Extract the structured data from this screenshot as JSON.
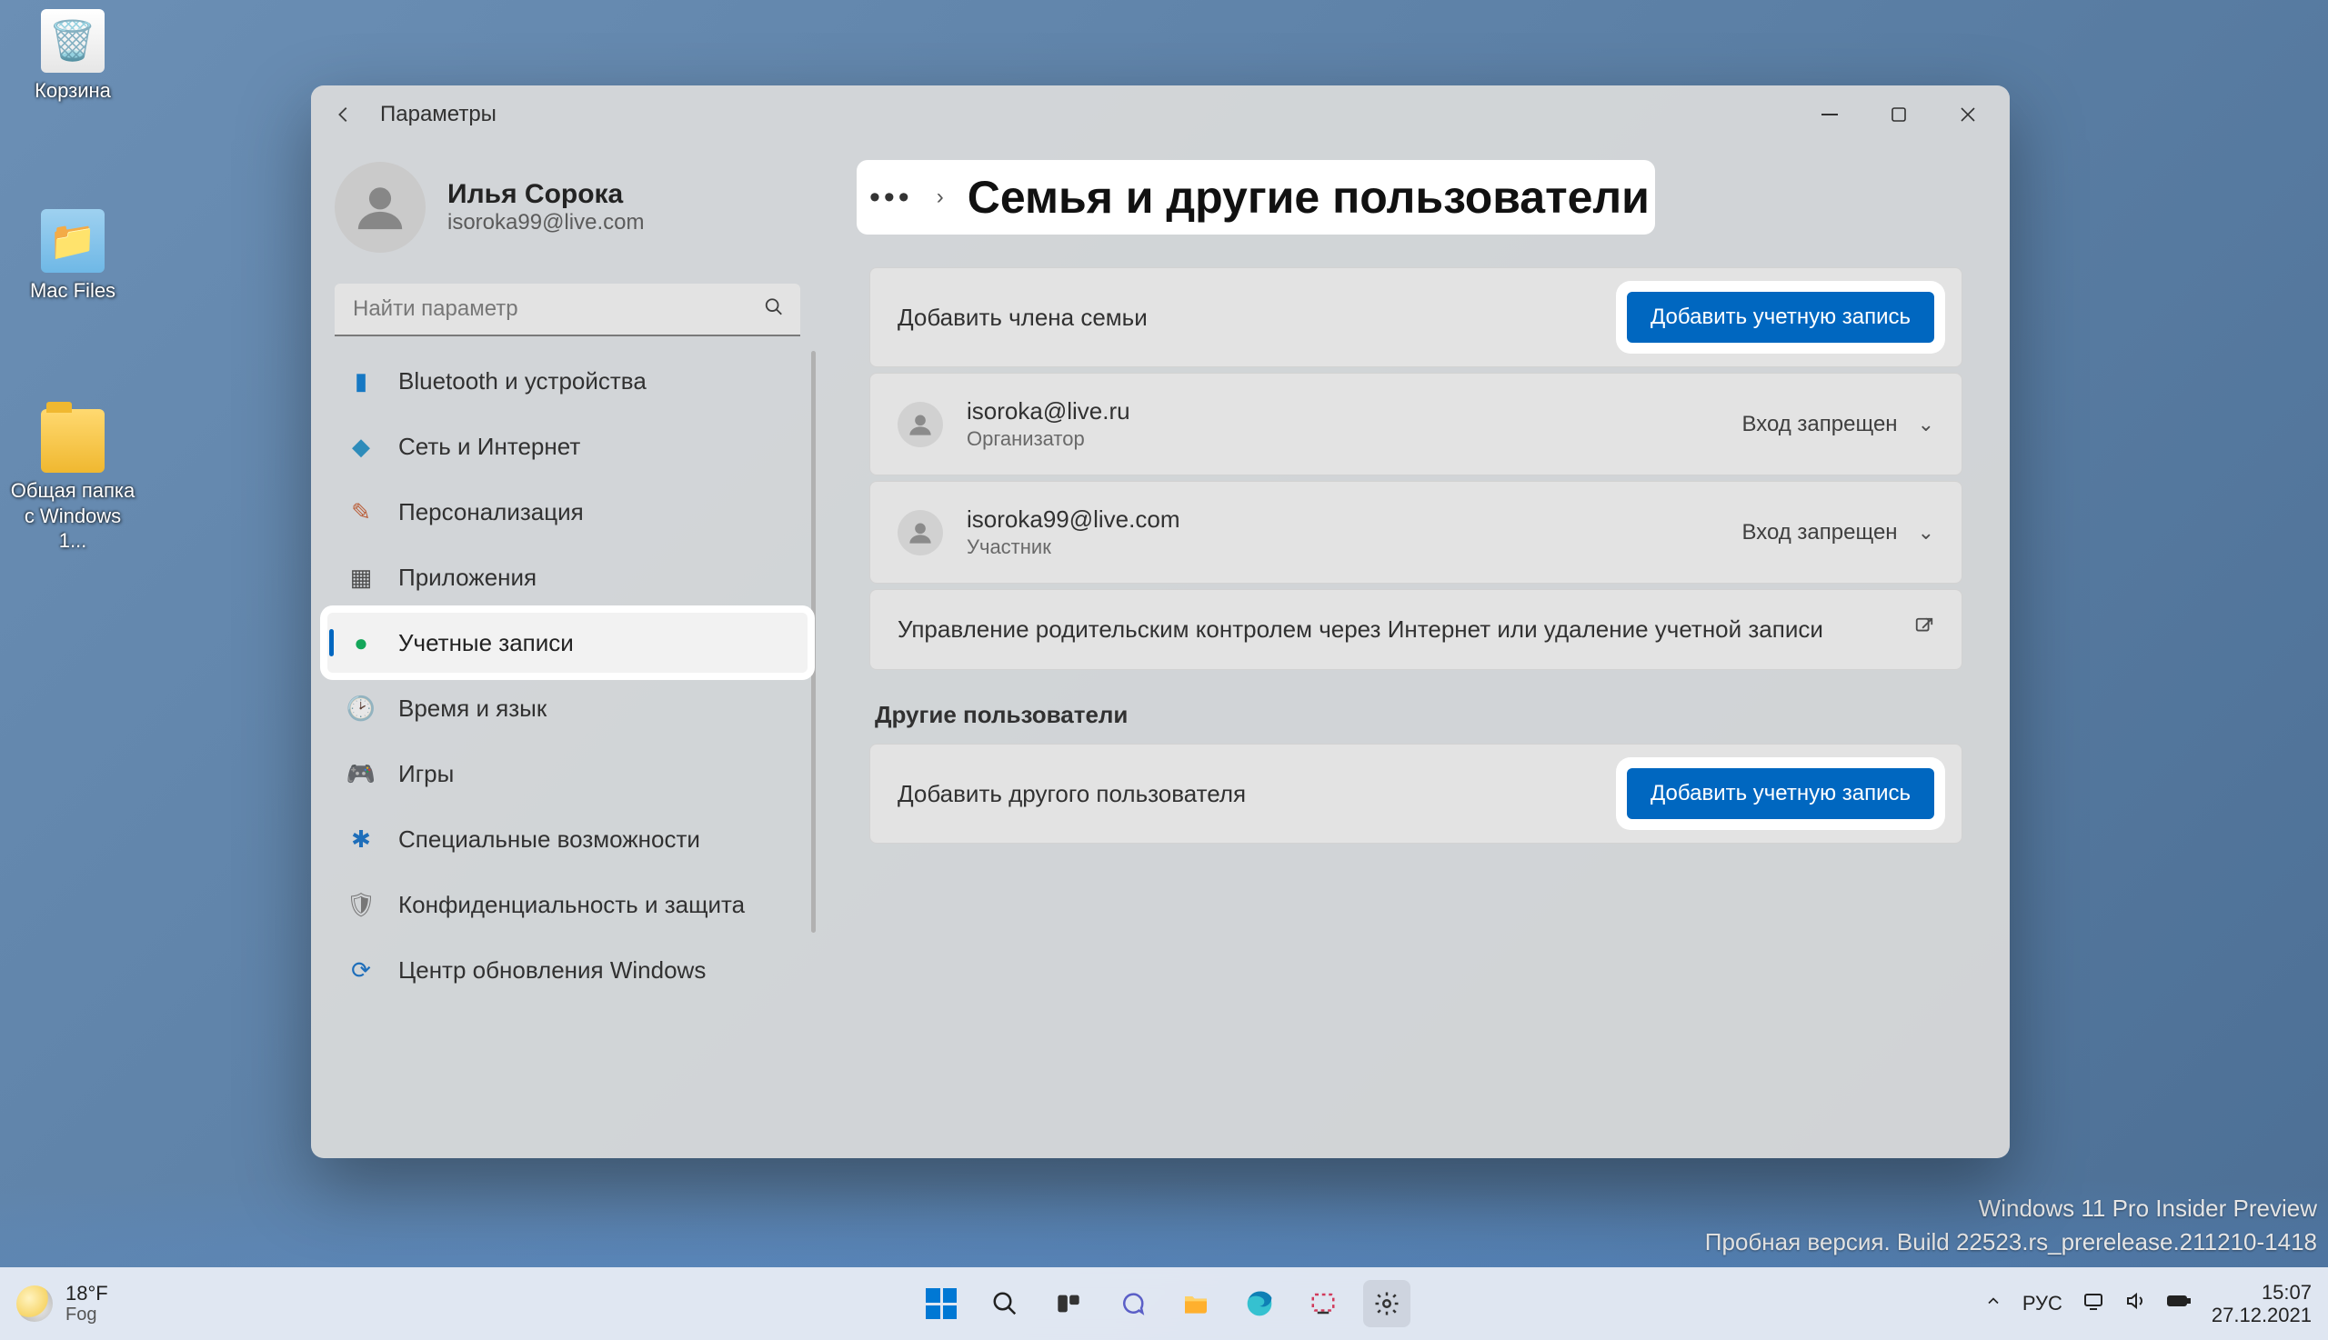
{
  "desktop": {
    "recycle": "Корзина",
    "mac": "Mac Files",
    "shared": "Общая папка с Windows 1..."
  },
  "watermark": {
    "line1": "Windows 11 Pro Insider Preview",
    "line2": "Пробная версия. Build 22523.rs_prerelease.211210-1418"
  },
  "taskbar": {
    "temp": "18°F",
    "cond": "Fog",
    "lang": "РУС",
    "time": "15:07",
    "date": "27.12.2021"
  },
  "settings": {
    "app_title": "Параметры",
    "profile": {
      "name": "Илья Сорока",
      "mail": "isoroka99@live.com"
    },
    "search_placeholder": "Найти параметр",
    "nav": [
      {
        "icon": "🟦",
        "label": "Bluetooth и устройства"
      },
      {
        "icon": "💠",
        "label": "Сеть и Интернет"
      },
      {
        "icon": "🖌️",
        "label": "Персонализация"
      },
      {
        "icon": "▦",
        "label": "Приложения"
      },
      {
        "icon": "👤",
        "label": "Учетные записи",
        "active": true
      },
      {
        "icon": "🕑",
        "label": "Время и язык"
      },
      {
        "icon": "🎮",
        "label": "Игры"
      },
      {
        "icon": "✱",
        "label": "Специальные возможности"
      },
      {
        "icon": "🛡️",
        "label": "Конфиденциальность и защита"
      },
      {
        "icon": "🔄",
        "label": "Центр обновления Windows"
      }
    ],
    "bread": {
      "title": "Семья и другие пользователи"
    },
    "cards": {
      "add_family_label": "Добавить члена семьи",
      "add_family_btn": "Добавить учетную запись",
      "family": [
        {
          "name": "isoroka@live.ru",
          "role": "Организатор",
          "status": "Вход запрещен"
        },
        {
          "name": "isoroka99@live.com",
          "role": "Участник",
          "status": "Вход запрещен"
        }
      ],
      "parental": "Управление родительским контролем через Интернет или удаление учетной записи",
      "other_title": "Другие пользователи",
      "add_other_label": "Добавить другого пользователя",
      "add_other_btn": "Добавить учетную запись"
    }
  }
}
